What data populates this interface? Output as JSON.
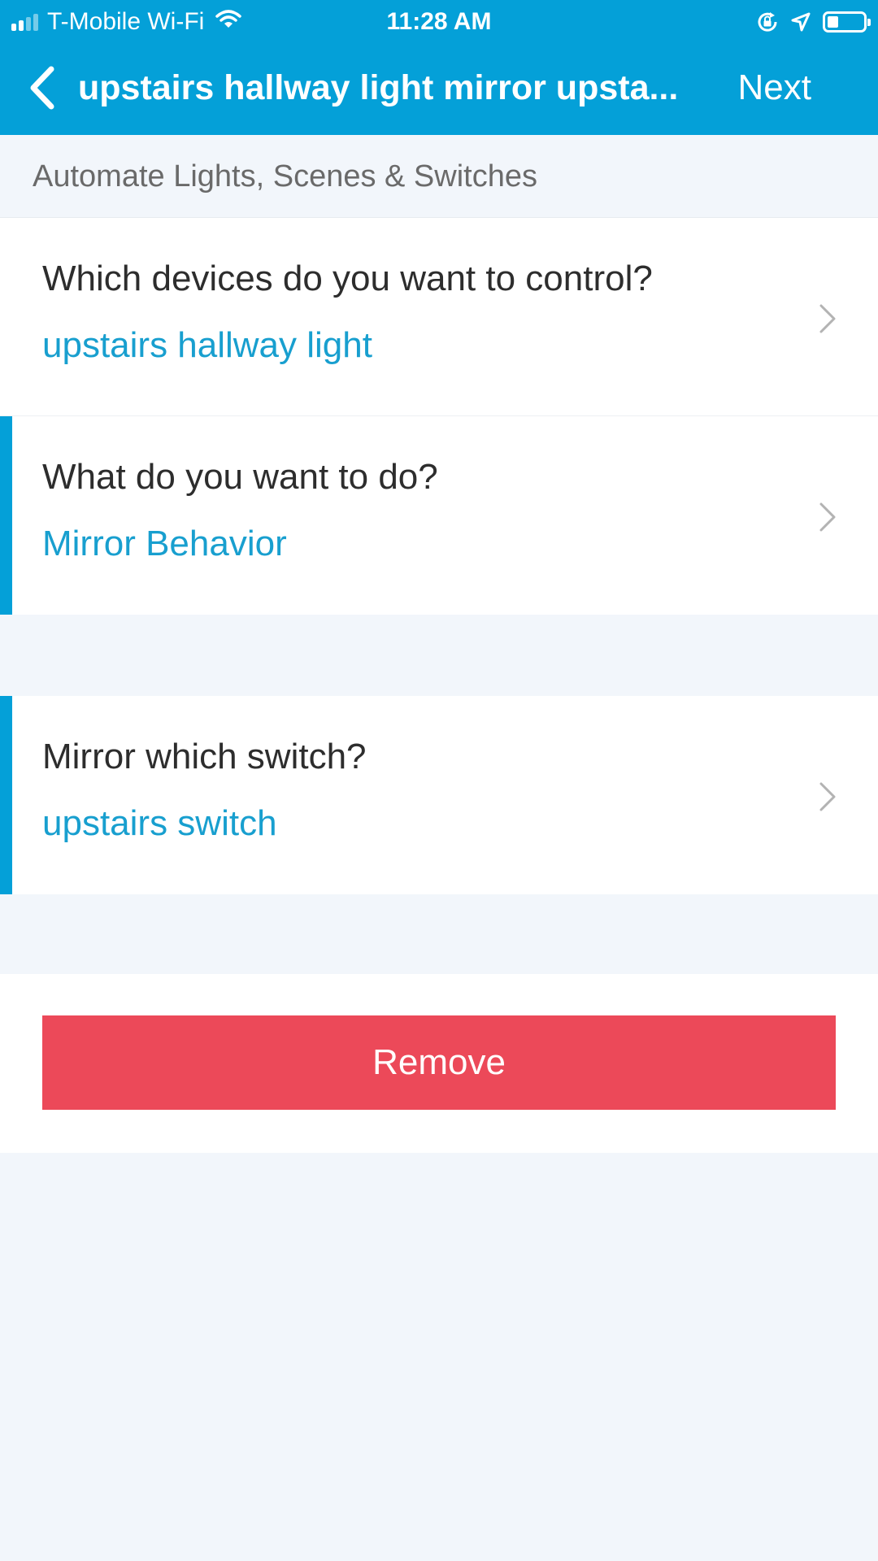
{
  "status_bar": {
    "carrier": "T-Mobile Wi-Fi",
    "time": "11:28 AM",
    "signal_bars_active": 2,
    "signal_bars_total": 4,
    "battery_level": 0.3,
    "icons": [
      "signal-icon",
      "wifi-icon",
      "orientation-lock-icon",
      "location-icon",
      "battery-icon"
    ]
  },
  "nav": {
    "back_icon": "chevron-left-icon",
    "title": "upstairs hallway light mirror upsta...",
    "next_label": "Next"
  },
  "section": {
    "header": "Automate Lights, Scenes & Switches"
  },
  "rows": [
    {
      "question": "Which devices do you want to control?",
      "answer": "upstairs hallway light"
    },
    {
      "question": "What do you want to do?",
      "answer": "Mirror Behavior"
    },
    {
      "question": "Mirror which switch?",
      "answer": "upstairs switch"
    }
  ],
  "actions": {
    "remove_label": "Remove"
  },
  "colors": {
    "header": "#04a0d8",
    "accent": "#04a0d8",
    "answer_text": "#189fcf",
    "remove": "#ec4959",
    "background": "#f2f6fb"
  }
}
